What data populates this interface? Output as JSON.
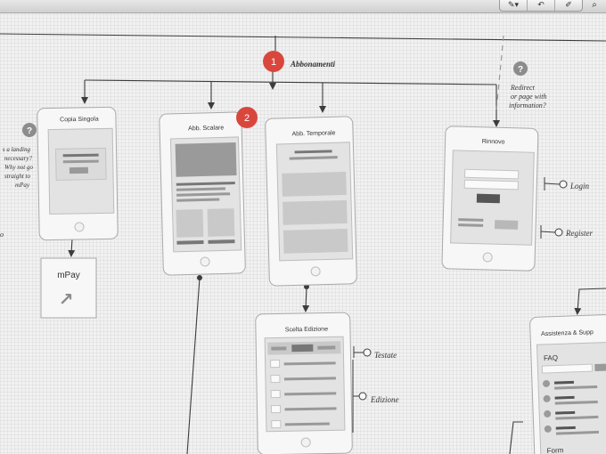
{
  "toolbar": {
    "buttons": [
      {
        "name": "pen-tool-icon",
        "glyph": "✎▾"
      },
      {
        "name": "undo-icon",
        "glyph": "↶"
      },
      {
        "name": "edit-icon",
        "glyph": "✐"
      }
    ],
    "search_icon": "⌕"
  },
  "nodes": {
    "abbonamenti": {
      "badge": "1",
      "label": "Abbonamenti"
    },
    "copia_singola": {
      "title": "Copia Singola"
    },
    "abb_scalare": {
      "title": "Abb. Scalare",
      "badge": "2"
    },
    "abb_temporale": {
      "title": "Abb. Temporale"
    },
    "rinnovo": {
      "title": "Rinnovo"
    },
    "mpay": {
      "title": "mPay",
      "icon": "↗"
    },
    "scelta_edizione": {
      "title": "Scelta Edizione"
    },
    "assistenza": {
      "title": "Assistenza & Supp",
      "faq": "FAQ",
      "form": "Form"
    }
  },
  "annotations": {
    "left_question": {
      "icon": "?",
      "lines": [
        "s a landing",
        "necessary?",
        "Why not go",
        "straight to",
        "mPay"
      ]
    },
    "left_fragment": "o",
    "redirect": {
      "icon": "?",
      "lines": [
        "Redirect",
        "or page with",
        "information?"
      ]
    },
    "login": "Login",
    "register": "Register",
    "testate": "Testate",
    "edizione": "Edizione"
  },
  "colors": {
    "badge_red": "#d9473c",
    "question_grey": "#8c8c8c",
    "line": "#3c3c3c",
    "phone_border": "#a9a9a9",
    "phone_bg": "#f7f7f7",
    "screen_bg": "#e3e3e3",
    "block": "#c9c9c9",
    "bar": "#9a9a9a",
    "dark_bar": "#555555"
  }
}
